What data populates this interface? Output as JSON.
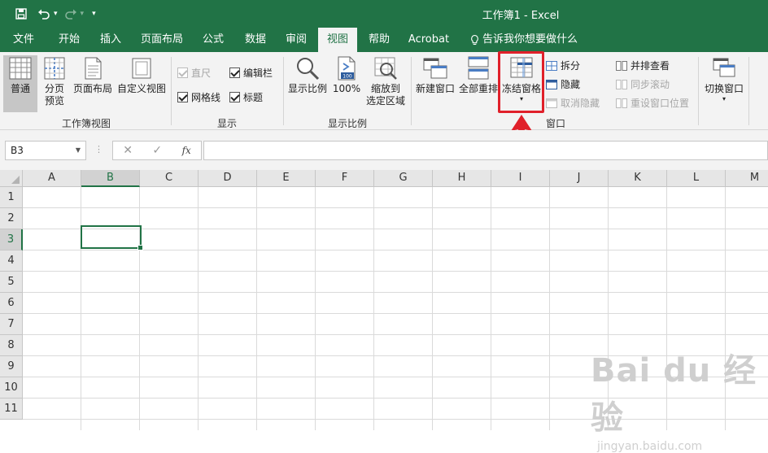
{
  "window": {
    "title": "工作簿1  -  Excel"
  },
  "tabs": [
    {
      "label": "文件"
    },
    {
      "label": "开始"
    },
    {
      "label": "插入"
    },
    {
      "label": "页面布局"
    },
    {
      "label": "公式"
    },
    {
      "label": "数据"
    },
    {
      "label": "审阅"
    },
    {
      "label": "视图"
    },
    {
      "label": "帮助"
    },
    {
      "label": "Acrobat"
    }
  ],
  "tell_me": "告诉我你想要做什么",
  "ribbon": {
    "workbook_views": {
      "label": "工作簿视图",
      "normal": "普通",
      "page_break_1": "分页",
      "page_break_2": "预览",
      "page_layout": "页面布局",
      "custom_views": "自定义视图"
    },
    "show": {
      "label": "显示",
      "ruler": "直尺",
      "gridlines": "网格线",
      "formula_bar": "编辑栏",
      "headings": "标题"
    },
    "zoom": {
      "label": "显示比例",
      "zoom": "显示比例",
      "hundred": "100%",
      "zoom_sel_1": "缩放到",
      "zoom_sel_2": "选定区域",
      "icon_text": "100"
    },
    "window": {
      "label": "窗口",
      "new_window": "新建窗口",
      "arrange_all": "全部重排",
      "freeze_panes": "冻结窗格",
      "split": "拆分",
      "hide": "隐藏",
      "unhide": "取消隐藏",
      "side_by_side": "并排查看",
      "sync_scroll": "同步滚动",
      "reset_position": "重设窗口位置",
      "switch_windows": "切换窗口"
    }
  },
  "formula_bar": {
    "name_box": "B3",
    "fx": "fx",
    "cancel": "✕",
    "enter": "✓",
    "value": ""
  },
  "grid": {
    "columns": [
      "A",
      "B",
      "C",
      "D",
      "E",
      "F",
      "G",
      "H",
      "I",
      "J",
      "K",
      "L",
      "M"
    ],
    "rows": [
      "1",
      "2",
      "3",
      "4",
      "5",
      "6",
      "7",
      "8",
      "9",
      "10",
      "11"
    ],
    "active_cell": "B3"
  },
  "watermark": {
    "line1": "Bai du 经验",
    "line2": "jingyan.baidu.com"
  },
  "colors": {
    "excel_green": "#217346",
    "highlight_red": "#e0202a"
  }
}
